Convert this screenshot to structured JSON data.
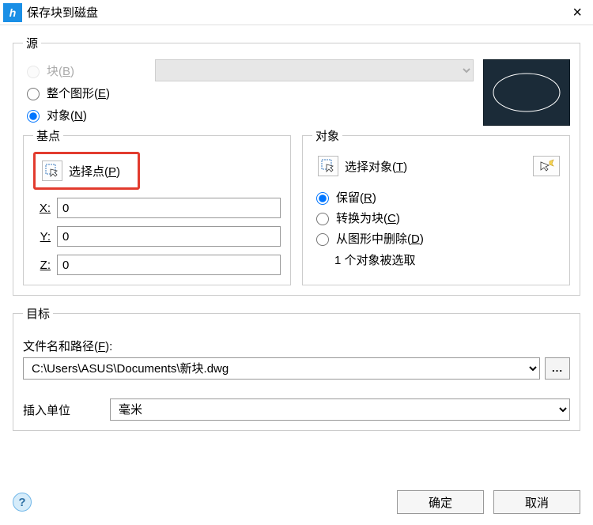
{
  "window": {
    "title": "保存块到磁盘",
    "close": "×"
  },
  "source": {
    "legend": "源",
    "radio_block": "块(B)",
    "radio_whole": "整个图形(E)",
    "radio_objects": "对象(N)",
    "selected": "objects"
  },
  "base_point": {
    "legend": "基点",
    "pick_label": "选择点(P)",
    "x_label": "X:",
    "y_label": "Y:",
    "z_label": "Z:",
    "x": "0",
    "y": "0",
    "z": "0"
  },
  "objects": {
    "legend": "对象",
    "select_label": "选择对象(T)",
    "radio_retain": "保留(R)",
    "radio_convert": "转换为块(C)",
    "radio_delete": "从图形中删除(D)",
    "status": "1 个对象被选取",
    "selected": "retain"
  },
  "destination": {
    "legend": "目标",
    "path_label": "文件名和路径(F):",
    "path": "C:\\Users\\ASUS\\Documents\\新块.dwg",
    "units_label": "插入单位",
    "units": "毫米"
  },
  "footer": {
    "help": "?",
    "ok": "确定",
    "cancel": "取消"
  }
}
